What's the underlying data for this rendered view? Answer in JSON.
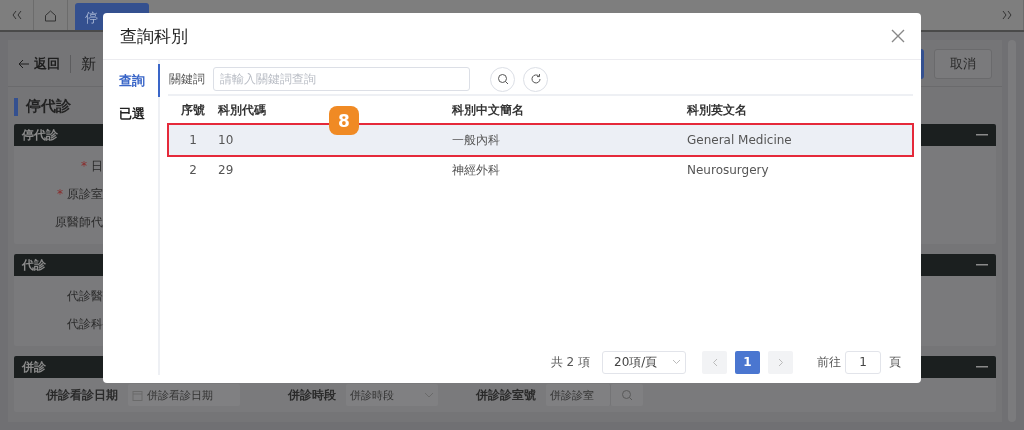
{
  "nav": {
    "tab": "停"
  },
  "page": {
    "back": "返回",
    "title": "新",
    "cancel": "取消",
    "heading": "停代診"
  },
  "sections": [
    {
      "title": "停代診",
      "fields": [
        {
          "label": "日",
          "marker": "*"
        },
        {
          "label": "原診室",
          "marker": "*"
        },
        {
          "label": "原醫師代"
        }
      ]
    },
    {
      "title": "代診",
      "fields": [
        {
          "label": "代診醫"
        },
        {
          "label": "代診科"
        }
      ]
    },
    {
      "title": "併診",
      "filters": [
        {
          "kind": "date",
          "label": "併診看診日期",
          "placeholder": "併診看診日期"
        },
        {
          "kind": "select",
          "label": "併診時段",
          "placeholder": "併診時段"
        },
        {
          "kind": "search",
          "label": "併診診室號",
          "placeholder": "併診診室"
        }
      ]
    }
  ],
  "dialog": {
    "title": "查詢科別",
    "tabs": [
      {
        "label": "查詢",
        "selected": true
      },
      {
        "label": "已選",
        "selected": false
      }
    ],
    "search": {
      "label": "關鍵詞",
      "placeholder": "請輸入關鍵詞查詢"
    },
    "table": {
      "columns": [
        "序號",
        "科別代碼",
        "科別中文簡名",
        "科別英文名"
      ],
      "rows": [
        {
          "cells": [
            "1",
            "10",
            "一般內科",
            "General Medicine"
          ],
          "selected": true,
          "marked": true
        },
        {
          "cells": [
            "2",
            "29",
            "神經外科",
            "Neurosurgery"
          ],
          "selected": false,
          "marked": false
        }
      ]
    },
    "callout": "8",
    "pagination": {
      "total": "共 2 項",
      "page_size": "20項/頁",
      "pages": [
        {
          "label": "1",
          "selected": true
        }
      ],
      "goto_label": "前往",
      "goto_value": "1",
      "goto_suffix": "頁"
    }
  }
}
